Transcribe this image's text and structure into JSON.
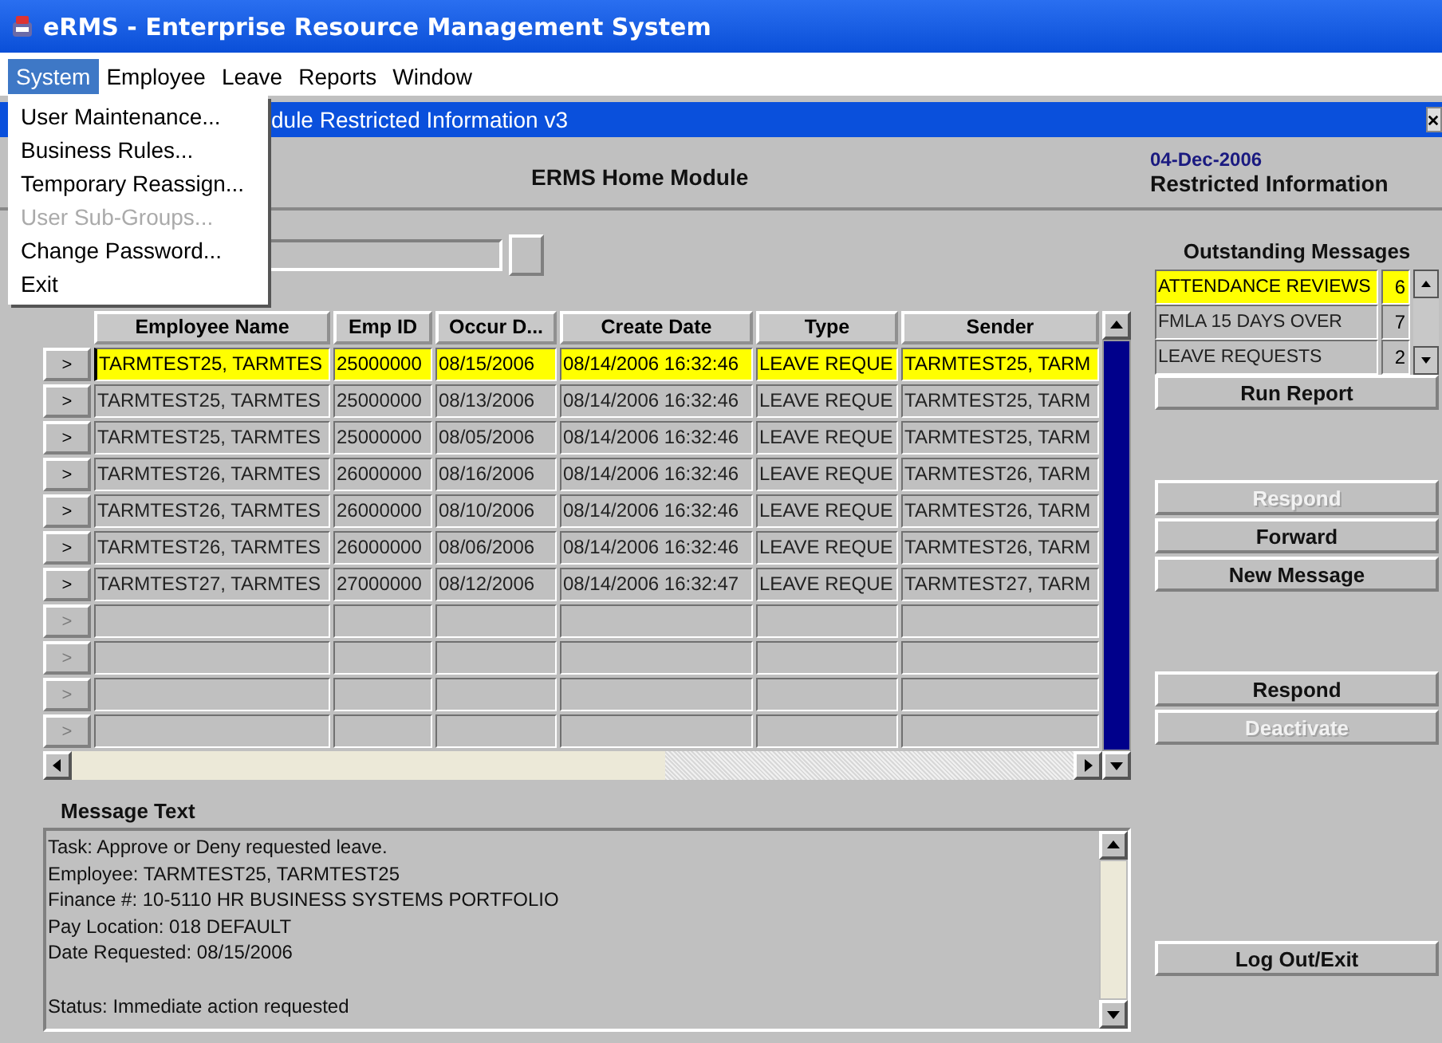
{
  "window": {
    "title": "eRMS - Enterprise Resource Management System"
  },
  "menu_bar": [
    {
      "label": "System",
      "selected": true
    },
    {
      "label": "Employee",
      "selected": false
    },
    {
      "label": "Leave",
      "selected": false
    },
    {
      "label": "Reports",
      "selected": false
    },
    {
      "label": "Window",
      "selected": false
    }
  ],
  "open_menu": [
    {
      "label": "User Maintenance...",
      "disabled": false
    },
    {
      "label": "Business Rules...",
      "disabled": false
    },
    {
      "label": "Temporary Reassign...",
      "disabled": false
    },
    {
      "label": "User Sub-Groups...",
      "disabled": true
    },
    {
      "label": "Change Password...",
      "disabled": false
    },
    {
      "label": "Exit",
      "disabled": false
    }
  ],
  "inner_window": {
    "title": "dule Restricted Information v3"
  },
  "header": {
    "title": "ERMS Home Module",
    "date": "04-Dec-2006",
    "subtitle": "Restricted Information"
  },
  "table": {
    "columns": [
      "Employee Name",
      "Emp ID",
      "Occur D...",
      "Create Date",
      "Type",
      "Sender"
    ],
    "rows": [
      {
        "button": ">",
        "disabled": false,
        "selected": true,
        "cells": [
          "TARMTEST25, TARMTES",
          "25000000",
          "08/15/2006",
          "08/14/2006 16:32:46",
          "LEAVE REQUE",
          "TARMTEST25, TARM"
        ]
      },
      {
        "button": ">",
        "disabled": false,
        "selected": false,
        "cells": [
          "TARMTEST25, TARMTES",
          "25000000",
          "08/13/2006",
          "08/14/2006 16:32:46",
          "LEAVE REQUE",
          "TARMTEST25, TARM"
        ]
      },
      {
        "button": ">",
        "disabled": false,
        "selected": false,
        "cells": [
          "TARMTEST25, TARMTES",
          "25000000",
          "08/05/2006",
          "08/14/2006 16:32:46",
          "LEAVE REQUE",
          "TARMTEST25, TARM"
        ]
      },
      {
        "button": ">",
        "disabled": false,
        "selected": false,
        "cells": [
          "TARMTEST26, TARMTES",
          "26000000",
          "08/16/2006",
          "08/14/2006 16:32:46",
          "LEAVE REQUE",
          "TARMTEST26, TARM"
        ]
      },
      {
        "button": ">",
        "disabled": false,
        "selected": false,
        "cells": [
          "TARMTEST26, TARMTES",
          "26000000",
          "08/10/2006",
          "08/14/2006 16:32:46",
          "LEAVE REQUE",
          "TARMTEST26, TARM"
        ]
      },
      {
        "button": ">",
        "disabled": false,
        "selected": false,
        "cells": [
          "TARMTEST26, TARMTES",
          "26000000",
          "08/06/2006",
          "08/14/2006 16:32:46",
          "LEAVE REQUE",
          "TARMTEST26, TARM"
        ]
      },
      {
        "button": ">",
        "disabled": false,
        "selected": false,
        "cells": [
          "TARMTEST27, TARMTES",
          "27000000",
          "08/12/2006",
          "08/14/2006 16:32:47",
          "LEAVE REQUE",
          "TARMTEST27, TARM"
        ]
      },
      {
        "button": ">",
        "disabled": true
      },
      {
        "button": ">",
        "disabled": true
      },
      {
        "button": ">",
        "disabled": true
      },
      {
        "button": ">",
        "disabled": true
      }
    ]
  },
  "outstanding_messages": {
    "title": "Outstanding Messages",
    "items": [
      {
        "label": "ATTENDANCE REVIEWS",
        "count": "6",
        "selected": true
      },
      {
        "label": "FMLA 15 DAYS OVER",
        "count": "7",
        "selected": false
      },
      {
        "label": "LEAVE REQUESTS",
        "count": "2",
        "selected": false
      }
    ]
  },
  "action_groups": [
    [
      {
        "label": "Run Report",
        "disabled": false
      }
    ],
    [
      {
        "label": "Respond",
        "disabled": true
      },
      {
        "label": "Forward",
        "disabled": false
      },
      {
        "label": "New Message",
        "disabled": false
      }
    ],
    [
      {
        "label": "Respond",
        "disabled": false
      },
      {
        "label": "Deactivate",
        "disabled": true
      }
    ],
    [
      {
        "label": "Log Out/Exit",
        "disabled": false
      }
    ]
  ],
  "message_text": {
    "label": "Message Text",
    "paragraphs": [
      "Task: Approve or Deny requested leave.\nEmployee: TARMTEST25, TARMTEST25\nFinance #: 10-5110 HR BUSINESS SYSTEMS PORTFOLIO\nPay Location: 018 DEFAULT\nDate Requested: 08/15/2006",
      "Status: Immediate action requested"
    ]
  }
}
